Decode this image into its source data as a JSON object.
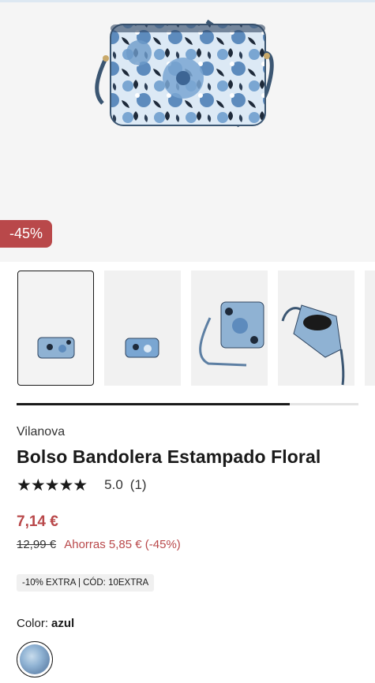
{
  "product": {
    "discount_badge": "-45%",
    "brand": "Vilanova",
    "title": "Bolso Bandolera Estampado Floral",
    "rating_stars": "★★★★★",
    "rating_value": "5.0",
    "rating_count": "(1)",
    "price": "7,14 €",
    "old_price": "12,99 €",
    "savings": "Ahorras 5,85 € (-45%)",
    "promo_code": "-10% EXTRA | CÓD: 10EXTRA",
    "color_label": "Color:",
    "color_value": "azul"
  },
  "gallery": {
    "thumbnail_count_visible": 5,
    "selected_index": 0,
    "scroll_progress": 0.8
  },
  "colors": {
    "accent": "#b9484a",
    "text": "#1a1a1a",
    "bag_blue": "#7aa6d2"
  }
}
